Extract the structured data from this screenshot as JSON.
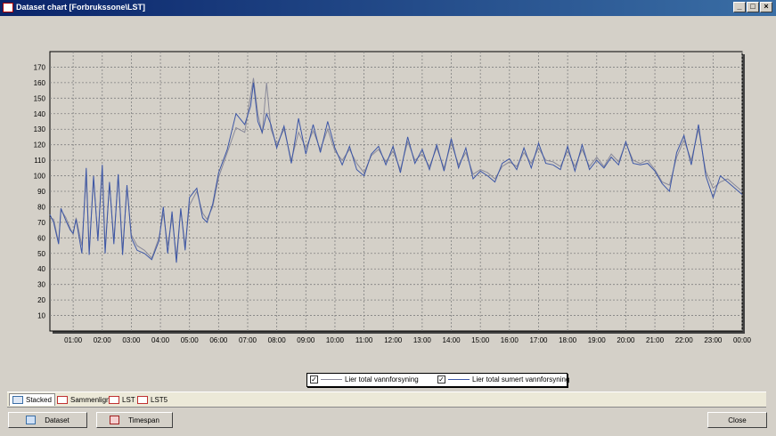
{
  "window": {
    "title": "Dataset chart [Forbrukssone\\LST]",
    "controls": [
      "_",
      "□",
      "×"
    ]
  },
  "chart_data": {
    "type": "line",
    "title": "",
    "xlabel": "",
    "ylabel": "",
    "ylim": [
      0,
      180
    ],
    "yticks": [
      10,
      20,
      30,
      40,
      50,
      60,
      70,
      80,
      90,
      100,
      110,
      120,
      130,
      140,
      150,
      160,
      170
    ],
    "xticks": [
      "01:00",
      "02:00",
      "03:00",
      "04:00",
      "05:00",
      "06:00",
      "07:00",
      "08:00",
      "09:00",
      "10:00",
      "11:00",
      "12:00",
      "13:00",
      "14:00",
      "15:00",
      "16:00",
      "17:00",
      "18:00",
      "19:00",
      "20:00",
      "21:00",
      "22:00",
      "23:00",
      "00:00"
    ],
    "xlim_hours": [
      0.2,
      24.0
    ],
    "grid": true,
    "legend_position": "bottom-center",
    "series": [
      {
        "name": "Lier total vannforsyning",
        "color": "#8a8a9a",
        "x": [
          0.2,
          0.33,
          0.5,
          0.58,
          0.75,
          0.9,
          1.0,
          1.1,
          1.3,
          1.45,
          1.55,
          1.7,
          1.85,
          2.0,
          2.1,
          2.25,
          2.4,
          2.55,
          2.7,
          2.85,
          3.0,
          3.2,
          3.45,
          3.7,
          3.95,
          4.1,
          4.25,
          4.4,
          4.55,
          4.7,
          4.85,
          5.0,
          5.25,
          5.45,
          5.6,
          5.8,
          6.0,
          6.3,
          6.6,
          6.9,
          7.1,
          7.2,
          7.35,
          7.5,
          7.65,
          7.8,
          8.0,
          8.25,
          8.5,
          8.75,
          9.0,
          9.25,
          9.5,
          9.75,
          10.0,
          10.25,
          10.5,
          10.75,
          11.0,
          11.25,
          11.5,
          11.75,
          12.0,
          12.25,
          12.5,
          12.75,
          13.0,
          13.25,
          13.5,
          13.75,
          14.0,
          14.25,
          14.5,
          14.75,
          15.0,
          15.25,
          15.5,
          15.75,
          16.0,
          16.25,
          16.5,
          16.75,
          17.0,
          17.25,
          17.5,
          17.75,
          18.0,
          18.25,
          18.5,
          18.75,
          19.0,
          19.25,
          19.5,
          19.75,
          20.0,
          20.25,
          20.5,
          20.75,
          21.0,
          21.25,
          21.5,
          21.75,
          22.0,
          22.25,
          22.5,
          22.75,
          23.0,
          23.25,
          23.5,
          23.75,
          24.0
        ],
        "y": [
          73,
          72,
          57,
          78,
          73,
          66,
          62,
          73,
          55,
          100,
          52,
          98,
          60,
          104,
          53,
          95,
          58,
          100,
          52,
          92,
          62,
          55,
          52,
          47,
          60,
          76,
          55,
          73,
          48,
          78,
          55,
          81,
          90,
          76,
          72,
          80,
          99,
          115,
          131,
          128,
          152,
          163,
          140,
          127,
          160,
          130,
          120,
          130,
          110,
          128,
          118,
          129,
          117,
          130,
          116,
          110,
          117,
          108,
          102,
          113,
          117,
          109,
          116,
          104,
          122,
          110,
          114,
          106,
          118,
          105,
          121,
          107,
          115,
          101,
          104,
          102,
          98,
          106,
          109,
          106,
          115,
          108,
          118,
          110,
          109,
          106,
          116,
          106,
          117,
          106,
          112,
          106,
          114,
          109,
          121,
          110,
          108,
          110,
          104,
          96,
          94,
          112,
          123,
          110,
          130,
          103,
          92,
          96,
          98,
          94,
          90
        ]
      },
      {
        "name": "Lier total sumert vannforsyning",
        "color": "#3c56a6",
        "x": [
          0.2,
          0.33,
          0.5,
          0.58,
          0.75,
          0.9,
          1.0,
          1.1,
          1.3,
          1.45,
          1.55,
          1.7,
          1.85,
          2.0,
          2.1,
          2.25,
          2.4,
          2.55,
          2.7,
          2.85,
          3.0,
          3.2,
          3.45,
          3.7,
          3.95,
          4.1,
          4.25,
          4.4,
          4.55,
          4.7,
          4.85,
          5.0,
          5.25,
          5.45,
          5.6,
          5.8,
          6.0,
          6.3,
          6.6,
          6.9,
          7.1,
          7.2,
          7.35,
          7.5,
          7.65,
          7.8,
          8.0,
          8.25,
          8.5,
          8.75,
          9.0,
          9.25,
          9.5,
          9.75,
          10.0,
          10.25,
          10.5,
          10.75,
          11.0,
          11.25,
          11.5,
          11.75,
          12.0,
          12.25,
          12.5,
          12.75,
          13.0,
          13.25,
          13.5,
          13.75,
          14.0,
          14.25,
          14.5,
          14.75,
          15.0,
          15.25,
          15.5,
          15.75,
          16.0,
          16.25,
          16.5,
          16.75,
          17.0,
          17.25,
          17.5,
          17.75,
          18.0,
          18.25,
          18.5,
          18.75,
          19.0,
          19.25,
          19.5,
          19.75,
          20.0,
          20.25,
          20.5,
          20.75,
          21.0,
          21.25,
          21.5,
          21.75,
          22.0,
          22.25,
          22.5,
          22.75,
          23.0,
          23.25,
          23.5,
          23.75,
          24.0
        ],
        "y": [
          75,
          70,
          56,
          79,
          71,
          65,
          63,
          72,
          50,
          105,
          49,
          100,
          58,
          107,
          50,
          96,
          56,
          101,
          49,
          94,
          60,
          52,
          50,
          46,
          58,
          80,
          50,
          77,
          44,
          79,
          52,
          86,
          92,
          73,
          70,
          82,
          102,
          117,
          140,
          133,
          145,
          160,
          135,
          128,
          140,
          133,
          118,
          132,
          108,
          137,
          114,
          133,
          115,
          135,
          118,
          107,
          119,
          104,
          100,
          114,
          119,
          107,
          119,
          102,
          125,
          108,
          117,
          104,
          120,
          103,
          124,
          105,
          118,
          98,
          103,
          100,
          96,
          108,
          111,
          104,
          118,
          105,
          121,
          108,
          107,
          104,
          119,
          103,
          120,
          104,
          110,
          105,
          112,
          107,
          122,
          108,
          107,
          108,
          103,
          95,
          90,
          115,
          126,
          107,
          133,
          100,
          86,
          100,
          96,
          92,
          88
        ]
      }
    ]
  },
  "tabs": [
    {
      "label": "Stacked",
      "active": true
    },
    {
      "label": "Sammenlign",
      "active": false
    },
    {
      "label": "LST",
      "active": false
    },
    {
      "label": "LST5",
      "active": false
    }
  ],
  "buttons": {
    "dataset": "Dataset",
    "timespan": "Timespan",
    "close": "Close"
  }
}
